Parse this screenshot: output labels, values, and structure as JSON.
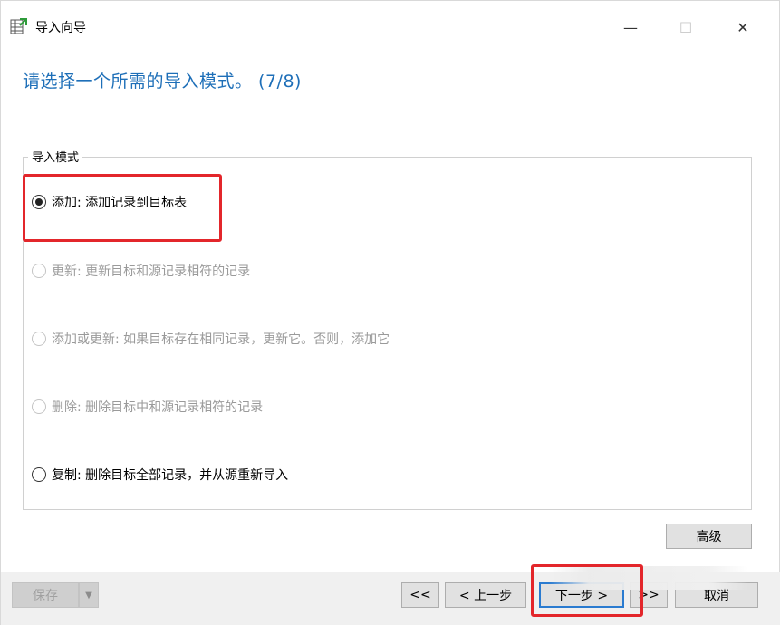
{
  "window": {
    "title": "导入向导",
    "controls": {
      "minimize": "—",
      "maximize": "☐",
      "close": "✕"
    }
  },
  "heading": "请选择一个所需的导入模式。 (7/8)",
  "group": {
    "legend": "导入模式",
    "options": [
      {
        "label": "添加: 添加记录到目标表",
        "checked": true,
        "disabled": false
      },
      {
        "label": "更新: 更新目标和源记录相符的记录",
        "checked": false,
        "disabled": true
      },
      {
        "label": "添加或更新: 如果目标存在相同记录，更新它。否则，添加它",
        "checked": false,
        "disabled": true
      },
      {
        "label": "删除: 删除目标中和源记录相符的记录",
        "checked": false,
        "disabled": true
      },
      {
        "label": "复制: 删除目标全部记录，并从源重新导入",
        "checked": false,
        "disabled": false
      }
    ]
  },
  "buttons": {
    "advanced": "高级",
    "save": "保存",
    "first": "<<",
    "prev": "< 上一步",
    "next": "下一步 >",
    "last": ">>",
    "cancel": "取消"
  },
  "colors": {
    "heading": "#1e6fb8",
    "highlight": "#e3262b",
    "focus_border": "#2a7bd0"
  }
}
